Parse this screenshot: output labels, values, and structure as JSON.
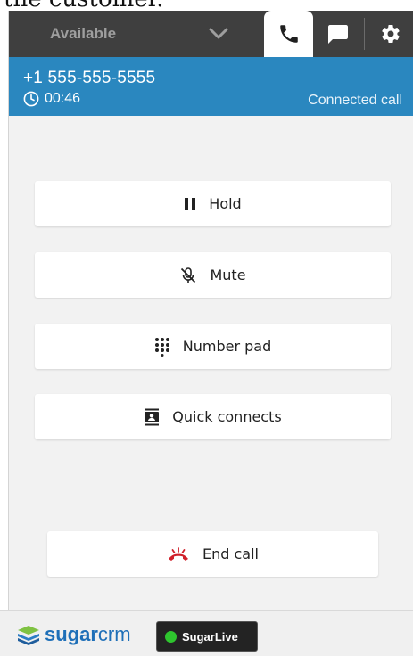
{
  "caption": {
    "text": "the customer."
  },
  "topbar": {
    "status_value": "Available",
    "tabs": [
      {
        "name": "phone",
        "icon": "phone-icon",
        "active": true
      },
      {
        "name": "chat",
        "icon": "chat-icon",
        "active": false
      },
      {
        "name": "settings",
        "icon": "gear-icon",
        "active": false
      }
    ]
  },
  "call": {
    "phone_number": "+1 555-555-5555",
    "timer": "00:46",
    "status": "Connected call",
    "bar_color": "#2a87bf"
  },
  "actions": {
    "hold": {
      "label": "Hold",
      "icon": "pause-icon"
    },
    "mute": {
      "label": "Mute",
      "icon": "mic-off-icon"
    },
    "number_pad": {
      "label": "Number pad",
      "icon": "dialpad-icon"
    },
    "quick_connects": {
      "label": "Quick connects",
      "icon": "contact-card-icon"
    },
    "end_call": {
      "label": "End call",
      "icon": "hang-up-icon",
      "icon_color": "#d0202a"
    }
  },
  "footer": {
    "logo_bold": "sugar",
    "logo_light": "crm",
    "sugarlive_label": "SugarLive",
    "status_dot_color": "#2ec52e"
  }
}
